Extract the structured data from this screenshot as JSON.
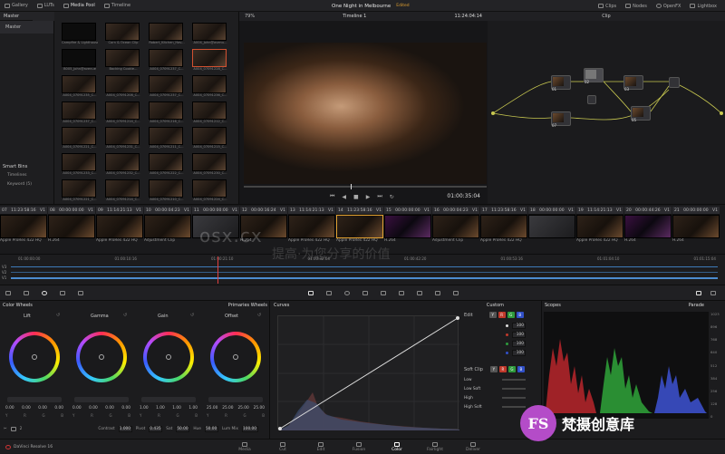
{
  "topbar": {
    "left": [
      "Gallery",
      "LUTs",
      "Media Pool",
      "Timeline"
    ],
    "title": "One Night in Melbourne",
    "status": "Edited",
    "right": [
      "Clips",
      "Nodes",
      "OpenFX",
      "Lightbox"
    ]
  },
  "mediapool": {
    "header": "Master",
    "bin": "Master",
    "smart_bins": "Smart Bins",
    "smart_items": [
      "Timelines",
      "Keyword (5)"
    ],
    "thumbs": [
      "Campfire & Lighthouse",
      "Corn & Ocean Clip",
      "Robert_Kitchen_Hav...",
      "A004_John@avenu...",
      "B005_John@avenue",
      "Backing Cookie...",
      "A004_07091237_C...",
      "A004_07091228_C...",
      "A004_07091235_C...",
      "A004_07091208_C...",
      "A004_07091237_C...",
      "A004_07091236_C...",
      "A004_07091237_C...",
      "A004_07091214_C...",
      "A004_07091216_C...",
      "A004_07091212_C...",
      "A004_07091221_C...",
      "A004_07091231_C...",
      "A004_07091211_C...",
      "A004_07091215_C...",
      "A004_07091233_C...",
      "A004_07091232_C...",
      "A004_07091222_C...",
      "A004_07091230_C...",
      "A004_07091221_C...",
      "A004_07091214_C...",
      "A004_07091210_C...",
      "A004_07091224_C..."
    ]
  },
  "viewer": {
    "zoom": "79%",
    "timeline": "Timeline 1",
    "timecode": "11:24:04:14",
    "playhead_tc": "01:00:35:04"
  },
  "nodepanel": {
    "title": "Clip",
    "nodes": [
      "01",
      "02",
      "03",
      "04",
      "05",
      "06",
      "07"
    ]
  },
  "cliprow": {
    "clips": [
      {
        "num": "07",
        "tc": "11:23:58:16",
        "v": "V1",
        "label": "Apple ProRes 422 HQ"
      },
      {
        "num": "08",
        "tc": "00:00:00:00",
        "v": "V1",
        "label": "H.264"
      },
      {
        "num": "09",
        "tc": "11:14:21:13",
        "v": "V1",
        "label": "Apple ProRes 422 HQ"
      },
      {
        "num": "10",
        "tc": "00:00:04:23",
        "v": "V1",
        "label": "Adjustment Clip"
      },
      {
        "num": "11",
        "tc": "00:00:00:00",
        "v": "V1",
        "label": ""
      },
      {
        "num": "12",
        "tc": "00:00:16:24",
        "v": "V1",
        "label": "H.264"
      },
      {
        "num": "13",
        "tc": "11:14:21:13",
        "v": "V1",
        "label": "Apple ProRes 422 HQ"
      },
      {
        "num": "14",
        "tc": "11:23:58:16",
        "v": "V1",
        "label": "Apple ProRes 422 HQ"
      },
      {
        "num": "15",
        "tc": "00:00:00:00",
        "v": "V1",
        "label": "H.264"
      },
      {
        "num": "16",
        "tc": "00:00:04:23",
        "v": "V1",
        "label": "Adjustment Clip"
      },
      {
        "num": "17",
        "tc": "11:23:58:16",
        "v": "V1",
        "label": "Apple ProRes 422 HQ"
      },
      {
        "num": "18",
        "tc": "00:00:00:00",
        "v": "V1",
        "label": ""
      },
      {
        "num": "19",
        "tc": "11:14:21:13",
        "v": "V1",
        "label": "Apple ProRes 422 HQ"
      },
      {
        "num": "20",
        "tc": "00:00:44:26",
        "v": "V1",
        "label": "H.264"
      },
      {
        "num": "21",
        "tc": "00:00:00:00",
        "v": "V1",
        "label": "H.264"
      }
    ],
    "ruler": [
      "01:00:00:00",
      "01:00:10:16",
      "01:00:21:10",
      "01:00:32:04",
      "01:00:42:20",
      "01:00:53:16",
      "01:01:04:10",
      "01:01:15:04"
    ],
    "tracks": [
      "V3",
      "V2",
      "V1"
    ]
  },
  "colorwheels": {
    "title": "Color Wheels",
    "mode": "Primaries Wheels",
    "wheels": [
      {
        "name": "Lift",
        "vals": [
          "0.00",
          "0.00",
          "0.00",
          "0.00"
        ]
      },
      {
        "name": "Gamma",
        "vals": [
          "0.00",
          "0.00",
          "0.00",
          "0.00"
        ]
      },
      {
        "name": "Gain",
        "vals": [
          "1.00",
          "1.00",
          "1.00",
          "1.00"
        ]
      },
      {
        "name": "Offset",
        "vals": [
          "25.00",
          "25.00",
          "25.00",
          "25.00"
        ]
      }
    ],
    "channels": [
      "Y",
      "R",
      "G",
      "B"
    ],
    "bottom": {
      "contrast_label": "Contrast",
      "contrast": "1.000",
      "pivot_label": "Pivot",
      "pivot": "0.435",
      "sat_label": "Sat",
      "sat": "50.00",
      "hue_label": "Hue",
      "hue": "50.00",
      "lummix_label": "Lum Mix",
      "lummix": "100.00"
    },
    "page_num": "2"
  },
  "curves": {
    "title": "Curves",
    "mode": "Custom",
    "edit_label": "Edit",
    "edit_vals": [
      "100",
      "100",
      "100",
      "100"
    ],
    "softclip_label": "Soft Clip",
    "softclip_rows": [
      "Low",
      "Low Soft",
      "High",
      "High Soft"
    ]
  },
  "scopes": {
    "title": "Scopes",
    "mode": "Parade",
    "scale": [
      "1023",
      "896",
      "768",
      "640",
      "512",
      "384",
      "256",
      "128",
      "0"
    ]
  },
  "bottomnav": {
    "app": "DaVinci Resolve 16",
    "pages": [
      "Media",
      "Cut",
      "Edit",
      "Fusion",
      "Color",
      "Fairlight",
      "Deliver"
    ],
    "active": "Color"
  },
  "watermark": {
    "logo": "FS",
    "text": "梵摄创意库",
    "overlay1": "osx.cx",
    "overlay2": "提高·为您分享的价值"
  }
}
